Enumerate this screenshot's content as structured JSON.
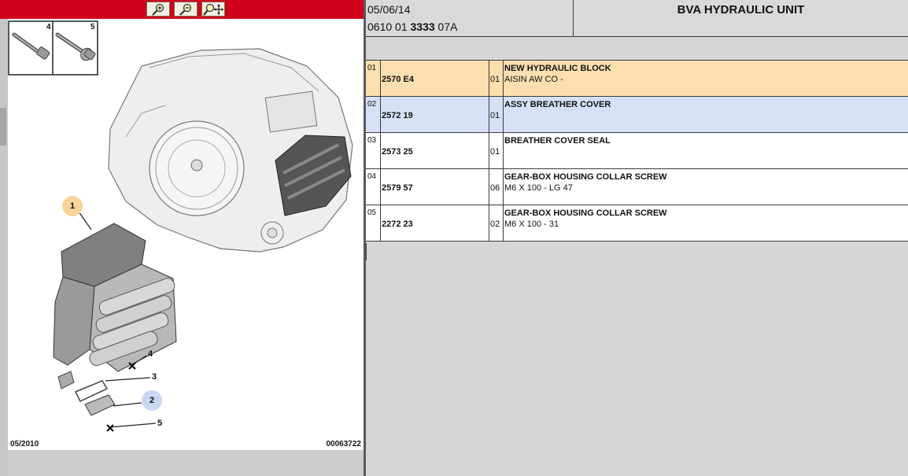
{
  "toolbar": {
    "buttons": [
      {
        "name": "zoom-in-button",
        "icon": "zoom-in-icon"
      },
      {
        "name": "zoom-out-button",
        "icon": "zoom-out-icon"
      },
      {
        "name": "zoom-pan-button",
        "icon": "zoom-pan-icon"
      }
    ],
    "colors": {
      "bar": "#d0021b"
    }
  },
  "diagram": {
    "thumbnails": [
      {
        "number": "4",
        "icon": "bolt-icon"
      },
      {
        "number": "5",
        "icon": "flanged-bolt-icon"
      }
    ],
    "callouts": [
      "1",
      "2",
      "3",
      "4",
      "5"
    ],
    "footer_left": "05/2010",
    "footer_right": "00063722",
    "callout_colors": {
      "1": "#f7d49a",
      "2": "#c9d7f2"
    }
  },
  "header": {
    "date": "05/06/14",
    "ref_prefix": "0610 01 ",
    "ref_bold": "3333",
    "ref_suffix": " 07A",
    "title": "BVA HYDRAULIC UNIT"
  },
  "parts": [
    {
      "idx": "01",
      "ref": "2570 E4",
      "qty": "01",
      "desc1": "NEW HYDRAULIC BLOCK",
      "desc2": "AISIN AW CO -",
      "bg": "#fbdfae"
    },
    {
      "idx": "02",
      "ref": "2572 19",
      "qty": "01",
      "desc1": "ASSY BREATHER COVER",
      "desc2": "",
      "bg": "#d6e1f7"
    },
    {
      "idx": "03",
      "ref": "2573 25",
      "qty": "01",
      "desc1": "BREATHER COVER SEAL",
      "desc2": "",
      "bg": "#ffffff"
    },
    {
      "idx": "04",
      "ref": "2579 57",
      "qty": "06",
      "desc1": "GEAR-BOX HOUSING COLLAR SCREW",
      "desc2": "M6 X 100 - LG 47",
      "bg": "#ffffff"
    },
    {
      "idx": "05",
      "ref": "2272 23",
      "qty": "02",
      "desc1": "GEAR-BOX HOUSING COLLAR SCREW",
      "desc2": "M6 X 100 - 31",
      "bg": "#ffffff"
    }
  ]
}
